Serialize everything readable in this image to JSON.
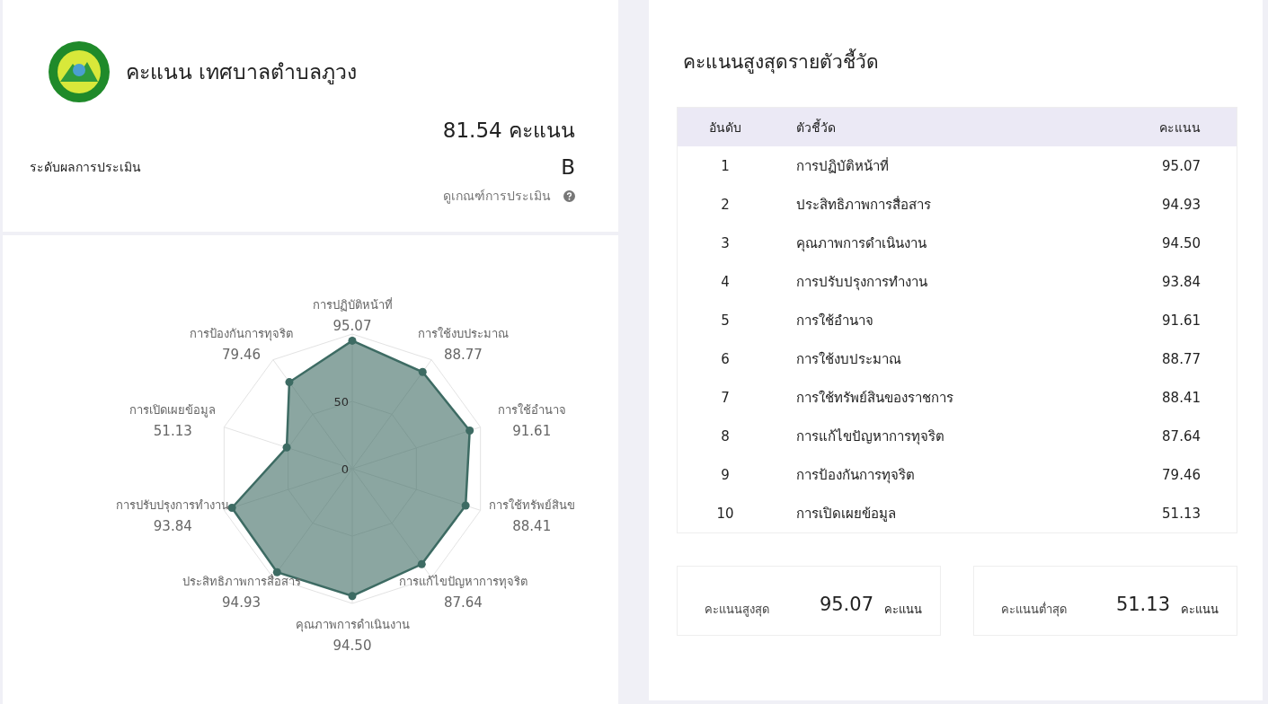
{
  "header": {
    "title": "คะแนน เทศบาลตำบลภูวง",
    "score": "81.54 คะแนน",
    "grade_label": "ระดับผลการประเมิน",
    "grade": "B",
    "criteria_link": "ดูเกณฑ์การประเมิน"
  },
  "radar": {
    "chart_data": {
      "type": "radar",
      "categories": [
        "การปฏิบัติหน้าที่",
        "การใช้งบประมาณ",
        "การใช้อำนาจ",
        "การใช้ทรัพย์สินข",
        "การแก้ไขปัญหาการทุจริต",
        "คุณภาพการดำเนินงาน",
        "ประสิทธิภาพการสื่อสาร",
        "การปรับปรุงการทำงาน",
        "การเปิดเผยข้อมูล",
        "การป้องกันการทุจริต"
      ],
      "series": [
        {
          "color": "#3d6b63",
          "values": [
            95.07,
            88.77,
            91.61,
            88.41,
            87.64,
            94.5,
            94.93,
            93.84,
            51.13,
            79.46
          ]
        }
      ],
      "ylim": [
        0,
        100
      ],
      "yticks": [
        0,
        50
      ],
      "value_labels": [
        "95.07",
        "88.77",
        "91.61",
        "88.41",
        "87.64",
        "94.50",
        "94.93",
        "93.84",
        "51.13",
        "79.46"
      ]
    }
  },
  "ranking": {
    "title": "คะแนนสูงสุดรายตัวชี้วัด",
    "columns": [
      "อันดับ",
      "ตัวชี้วัด",
      "คะแนน"
    ],
    "rows": [
      {
        "rank": "1",
        "indicator": "การปฏิบัติหน้าที่",
        "score": "95.07"
      },
      {
        "rank": "2",
        "indicator": "ประสิทธิภาพการสื่อสาร",
        "score": "94.93"
      },
      {
        "rank": "3",
        "indicator": "คุณภาพการดำเนินงาน",
        "score": "94.50"
      },
      {
        "rank": "4",
        "indicator": "การปรับปรุงการทำงาน",
        "score": "93.84"
      },
      {
        "rank": "5",
        "indicator": "การใช้อำนาจ",
        "score": "91.61"
      },
      {
        "rank": "6",
        "indicator": "การใช้งบประมาณ",
        "score": "88.77"
      },
      {
        "rank": "7",
        "indicator": "การใช้ทรัพย์สินของราชการ",
        "score": "88.41"
      },
      {
        "rank": "8",
        "indicator": "การแก้ไขปัญหาการทุจริต",
        "score": "87.64"
      },
      {
        "rank": "9",
        "indicator": "การป้องกันการทุจริต",
        "score": "79.46"
      },
      {
        "rank": "10",
        "indicator": "การเปิดเผยข้อมูล",
        "score": "51.13"
      }
    ]
  },
  "summary": [
    {
      "label": "คะแนนสูงสุด",
      "value": "95.07",
      "unit": "คะแนน"
    },
    {
      "label": "คะแนนต่ำสุด",
      "value": "51.13",
      "unit": "คะแนน"
    }
  ]
}
